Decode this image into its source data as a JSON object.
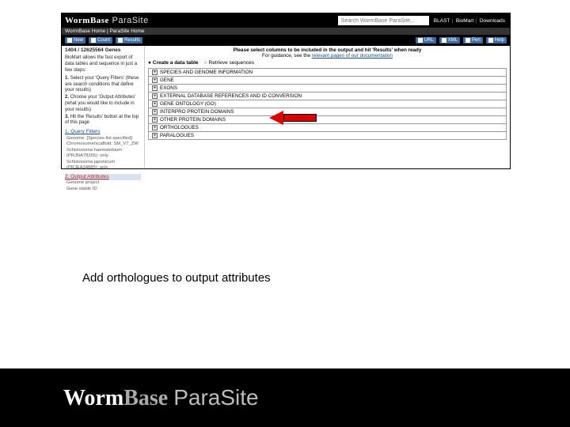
{
  "header": {
    "brand_worm": "WormBase",
    "brand_para": " ParaSite",
    "search_placeholder": "Search WormBase ParaSite...",
    "links": [
      "BLAST",
      "BioMart",
      "Downloads"
    ]
  },
  "crumbs": "WormBase Home | ParaSite Home",
  "buttons_left": [
    "New",
    "Count",
    "Results"
  ],
  "buttons_right": [
    "URL",
    "XML",
    "Perl",
    "Help"
  ],
  "instruction_bold": "Please select columns to be included in the output and hit 'Results' when ready",
  "instruction_sub_pre": "For guidance, see the ",
  "instruction_link": "relevant pages of our documentation",
  "tabs": [
    {
      "bullet": "●",
      "label": "Create a data table"
    },
    {
      "bullet": "○",
      "label": "Retrieve sequences"
    }
  ],
  "categories": [
    "SPECIES AND GENOME INFORMATION",
    "GENE",
    "EXONS",
    "EXTERNAL DATABASE REFERENCES AND ID CONVERSION",
    "GENE ONTOLOGY (GO)",
    "INTERPRO PROTEIN DOMAINS",
    "OTHER PROTEIN DOMAINS",
    "ORTHOLOGUES",
    "PARALOGUES"
  ],
  "sidebar": {
    "dataset": "1404 / 12625564 Genes",
    "intro": "BioMart allows the fast export of data tables and sequence in just a few steps:",
    "steps": [
      {
        "n": "1.",
        "t": "Select your 'Query Filters' (these are search conditions that define your results)"
      },
      {
        "n": "2.",
        "t": "Choose your 'Output Attributes' (what you would like to include in your results)"
      },
      {
        "n": "3.",
        "t": "Hit the 'Results' button at the top of this page"
      }
    ],
    "section1": "1. Query Filters",
    "s1_items": [
      "Genome: [Species-list specified]",
      "Chromosome/scaffold: SM_V7_ZW",
      "Schistosoma haematobium (PRJNA78265): only",
      "Schistosoma japonicum (PRJEA34885): only"
    ],
    "section2": "2. Output Attributes",
    "s2_items": [
      "Genome project",
      "Gene stable ID"
    ]
  },
  "caption": "Add orthologues to output attributes",
  "footer": {
    "worm": "Worm",
    "base": "Base ",
    "para": "ParaSite"
  }
}
